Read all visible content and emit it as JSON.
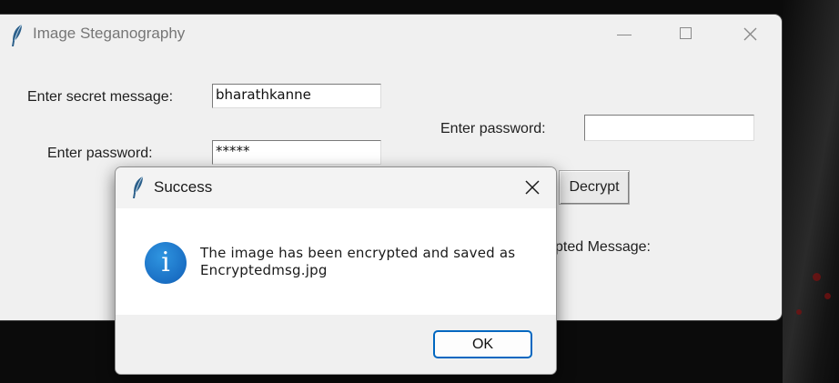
{
  "main_window": {
    "title": "Image Steganography",
    "icon": "feather-icon",
    "encrypt": {
      "secret_label": "Enter secret message:",
      "secret_value": "bharathkanne",
      "password_label": "Enter password:",
      "password_value": "*****"
    },
    "decrypt": {
      "password_label": "Enter password:",
      "password_value": "",
      "decrypt_button": "Decrypt",
      "decrypted_label_visible": "ypted Message:"
    }
  },
  "dialog": {
    "title": "Success",
    "icon": "info-icon",
    "icon_glyph": "i",
    "message_line1": "The image has been encrypted and saved as",
    "message_line2": "Encryptedmsg.jpg",
    "ok_label": "OK"
  },
  "colors": {
    "accent": "#0067c0",
    "info_blue": "#1a6fc4",
    "window_bg": "#f0f0f0"
  }
}
